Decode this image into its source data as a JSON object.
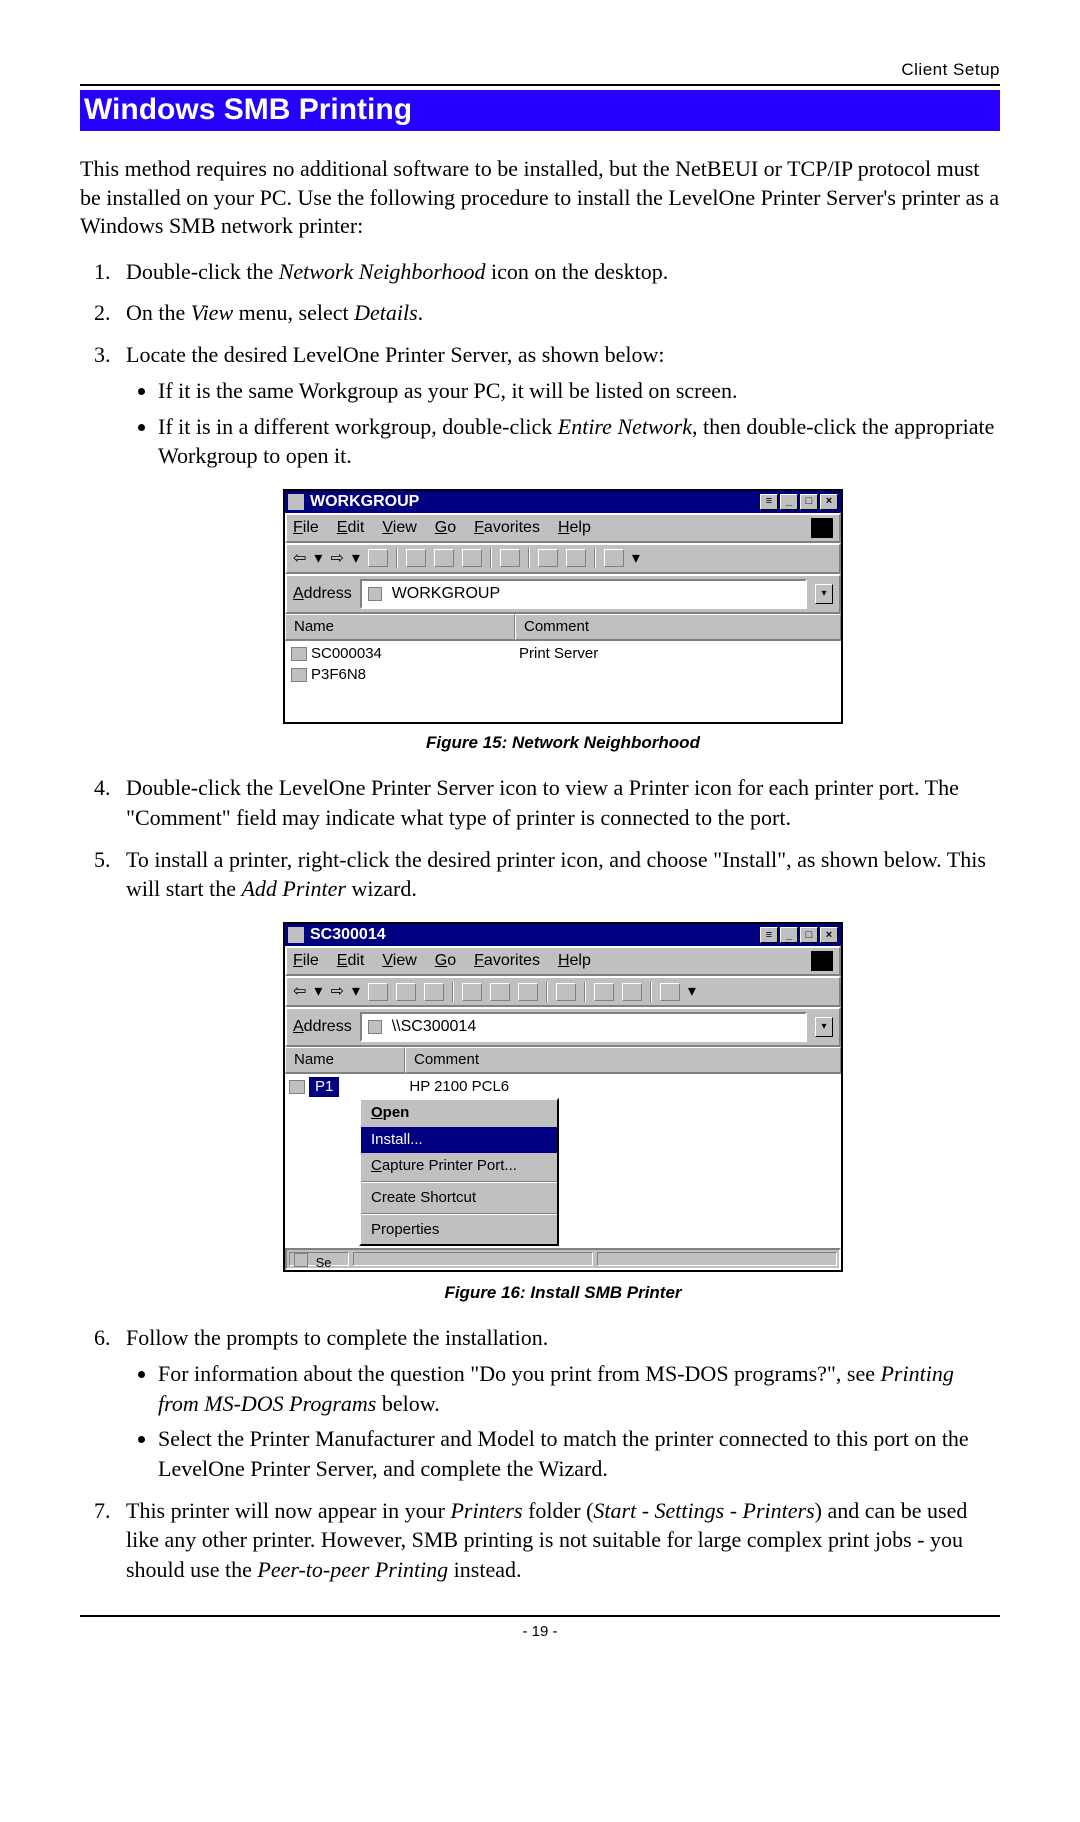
{
  "header": {
    "label": "Client Setup"
  },
  "section_title": "Windows SMB Printing",
  "intro": "This method requires no additional software to be installed, but the NetBEUI or TCP/IP protocol must be installed on your PC. Use the following procedure to install the LevelOne Printer Server's printer as a Windows SMB network printer:",
  "list": {
    "i1_pre": "Double-click the ",
    "i1_em": "Network Neighborhood",
    "i1_post": " icon on the desktop.",
    "i2_pre": "On the ",
    "i2_em1": "View",
    "i2_mid": " menu, select ",
    "i2_em2": "Details",
    "i2_post": ".",
    "i3": "Locate the desired LevelOne Printer Server, as shown below:",
    "i3b1": "If it is the same Workgroup as your PC, it will be listed on screen.",
    "i3b2_pre": "If it is in a different workgroup, double-click ",
    "i3b2_em": "Entire Network",
    "i3b2_post": ", then double-click the appropriate Workgroup to open it.",
    "i4": "Double-click the LevelOne Printer Server icon to view a Printer icon for each printer port. The \"Comment\" field may indicate what type of printer is connected to the port.",
    "i5_pre": "To install a printer, right-click the desired printer icon, and choose \"Install\", as shown below. This will start the ",
    "i5_em": "Add Printer",
    "i5_post": " wizard.",
    "i6": "Follow the prompts to complete the installation.",
    "i6b1_pre": "For information about the question \"Do you print from MS-DOS programs?\", see ",
    "i6b1_em": "Printing from MS-DOS Programs",
    "i6b1_post": " below.",
    "i6b2": "Select the Printer Manufacturer and Model to match the printer connected to this port on the LevelOne Printer Server, and complete the Wizard.",
    "i7_pre": "This printer will now appear in your ",
    "i7_em1": "Printers",
    "i7_mid1": " folder (",
    "i7_em2": "Start - Settings - Printers",
    "i7_mid2": ") and can be used like any other printer. However, SMB printing is not suitable for large complex print jobs - you should use the ",
    "i7_em3": "Peer-to-peer Printing",
    "i7_post": " instead."
  },
  "fig15": {
    "caption": "Figure 15: Network Neighborhood",
    "title": "WORKGROUP",
    "menu": {
      "file": "File",
      "edit": "Edit",
      "view": "View",
      "go": "Go",
      "fav": "Favorites",
      "help": "Help"
    },
    "addr_label": "Address",
    "addr_value": "WORKGROUP",
    "col_name": "Name",
    "col_comment": "Comment",
    "rows": [
      {
        "name": "SC000034",
        "comment": "Print Server"
      },
      {
        "name": "P3F6N8",
        "comment": ""
      }
    ]
  },
  "fig16": {
    "caption": "Figure 16: Install SMB Printer",
    "title": "SC300014",
    "menu": {
      "file": "File",
      "edit": "Edit",
      "view": "View",
      "go": "Go",
      "fav": "Favorites",
      "help": "Help"
    },
    "addr_label": "Address",
    "addr_value": "\\\\SC300014",
    "col_name": "Name",
    "col_comment": "Comment",
    "row_name": "P1",
    "row_comment": "HP 2100 PCL6",
    "ctx": {
      "open": "Open",
      "install": "Install...",
      "capture": "Capture Printer Port...",
      "shortcut": "Create Shortcut",
      "props": "Properties"
    },
    "status_text": "Se"
  },
  "footer": {
    "pagenum": "- 19 -"
  }
}
